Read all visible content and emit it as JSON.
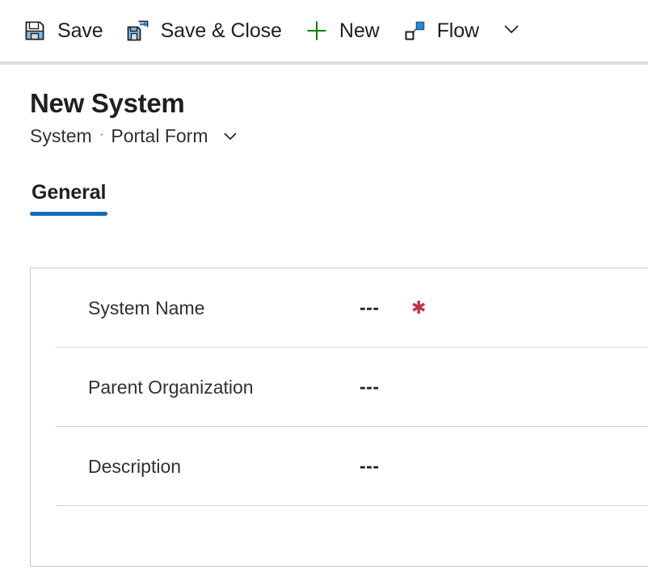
{
  "command_bar": {
    "buttons": [
      {
        "label": "Save",
        "icon": "save-floppy-icon"
      },
      {
        "label": "Save & Close",
        "icon": "save-and-close-icon"
      },
      {
        "label": "New",
        "icon": "plus-icon"
      },
      {
        "label": "Flow",
        "icon": "flow-icon"
      }
    ],
    "overflow_icon": "chevron-down-icon"
  },
  "header": {
    "title": "New System",
    "entity": "System",
    "separator": "·",
    "form_name": "Portal Form",
    "form_chevron_icon": "chevron-down-icon"
  },
  "tabs": [
    {
      "label": "General",
      "active": true
    }
  ],
  "form": {
    "fields": [
      {
        "label": "System Name",
        "required": true,
        "value": "---"
      },
      {
        "label": "Parent Organization",
        "required": false,
        "value": "---"
      },
      {
        "label": "Description",
        "required": false,
        "value": "---"
      }
    ]
  },
  "colors": {
    "accent": "#0f6cbd",
    "required": "#c4314b",
    "icon_blue": "#0078d4",
    "icon_green": "#107c10",
    "icon_dark": "#1f1f1f",
    "border": "#c8c6c4",
    "divider": "#d6d5d4",
    "toolbar_separator": "#dddddd"
  }
}
